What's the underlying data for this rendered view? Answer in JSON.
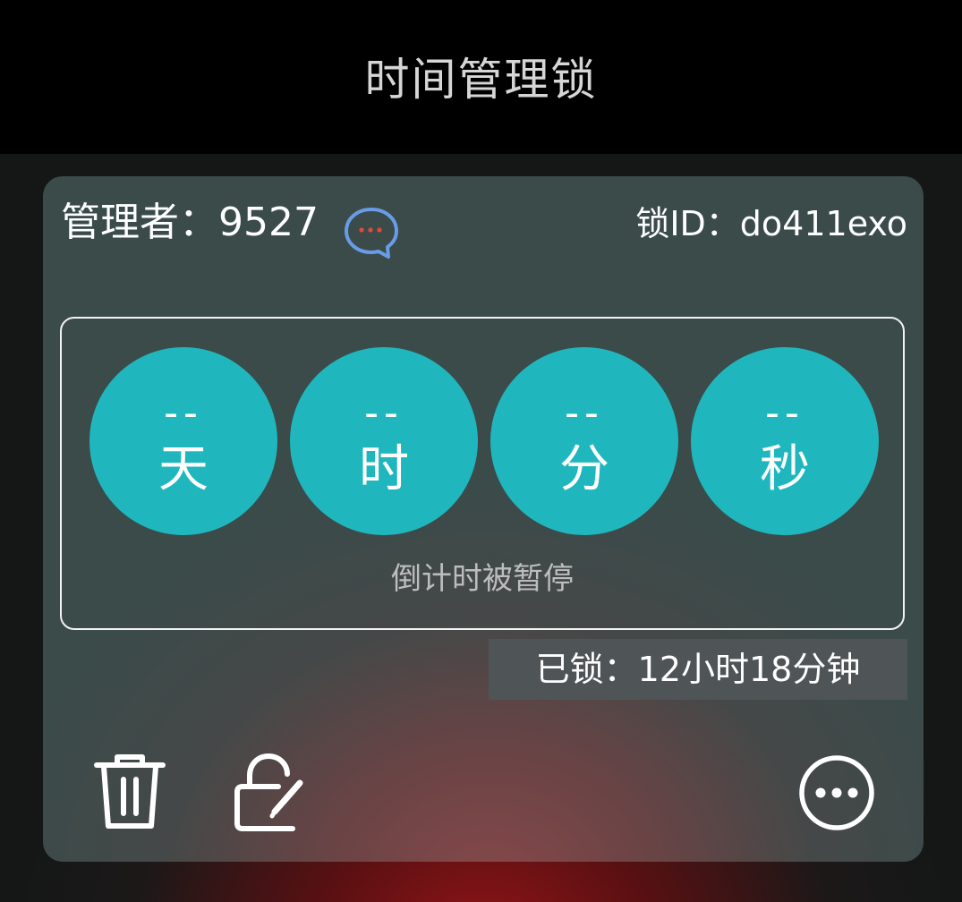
{
  "header": {
    "title": "时间管理锁"
  },
  "card": {
    "manager_label": "管理者：9527",
    "lock_id_label": "锁ID：do411exo",
    "countdown": [
      {
        "value": "--",
        "unit": "天"
      },
      {
        "value": "--",
        "unit": "时"
      },
      {
        "value": "--",
        "unit": "分"
      },
      {
        "value": "--",
        "unit": "秒"
      }
    ],
    "status_text": "倒计时被暂停",
    "locked_duration": "已锁：12小时18分钟"
  },
  "icons": {
    "message": "chat-bubble-icon",
    "delete": "trash-icon",
    "edit_lock": "unlock-edit-icon",
    "more": "more-horizontal-icon"
  },
  "colors": {
    "countdown_circle": "#1fb7bd",
    "chat_icon": "#6a9be6",
    "chat_dots": "#e04a3c",
    "topbar": "#000000"
  }
}
